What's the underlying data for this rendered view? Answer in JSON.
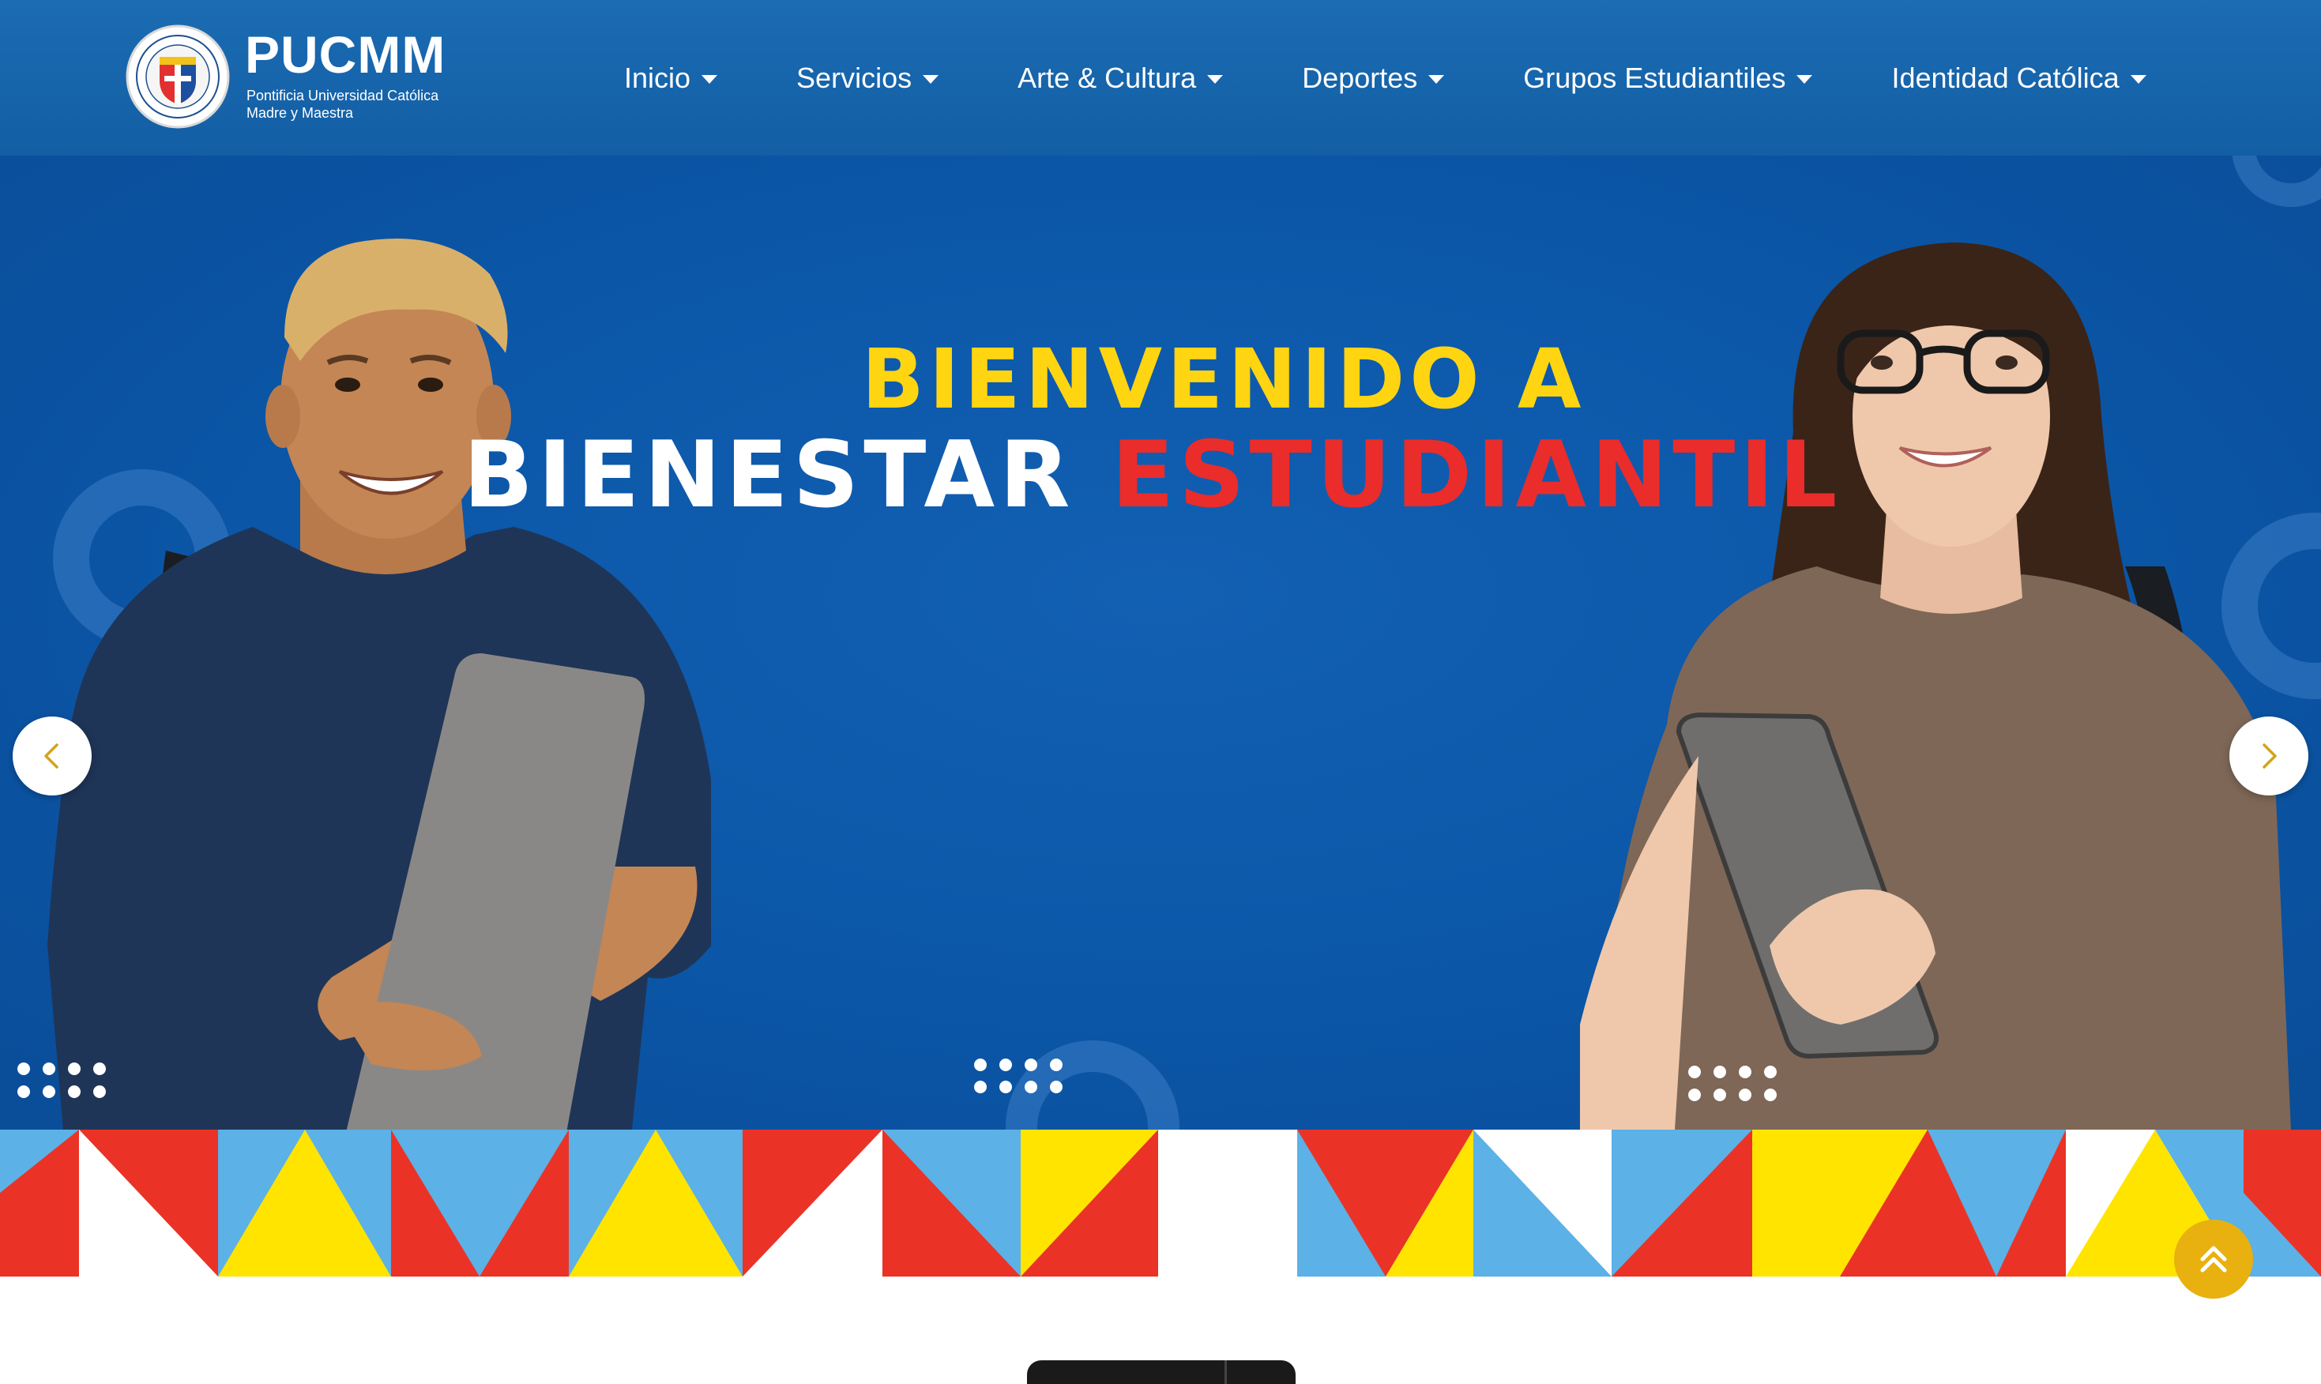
{
  "brand": {
    "name": "PUCMM",
    "subtitle_line1": "Pontificia Universidad Católica",
    "subtitle_line2": "Madre y Maestra",
    "seal_text_top": "PONTIFICIA UNIVERSIDAD CATÓLICA MADRE Y MAESTRA",
    "seal_text_bottom": "REPÚBLICA DOMINICANA"
  },
  "nav": {
    "items": [
      {
        "label": "Inicio"
      },
      {
        "label": "Servicios"
      },
      {
        "label": "Arte & Cultura"
      },
      {
        "label": "Deportes"
      },
      {
        "label": "Grupos Estudiantiles"
      },
      {
        "label": "Identidad Católica"
      }
    ]
  },
  "hero": {
    "line1": "BIENVENIDO A",
    "line2_white": "BIENESTAR",
    "line2_red": "ESTUDIANTIL",
    "prev_icon": "chevron-left-icon",
    "next_icon": "chevron-right-icon"
  },
  "scroll_top_icon": "double-chevron-up-icon",
  "colors": {
    "nav_bg": "#1b6cb3",
    "hero_bg": "#0b56a7",
    "yellow": "#ffd512",
    "red": "#ea2c2b",
    "light_blue": "#5cb1e6",
    "gold": "#e8b10f"
  }
}
